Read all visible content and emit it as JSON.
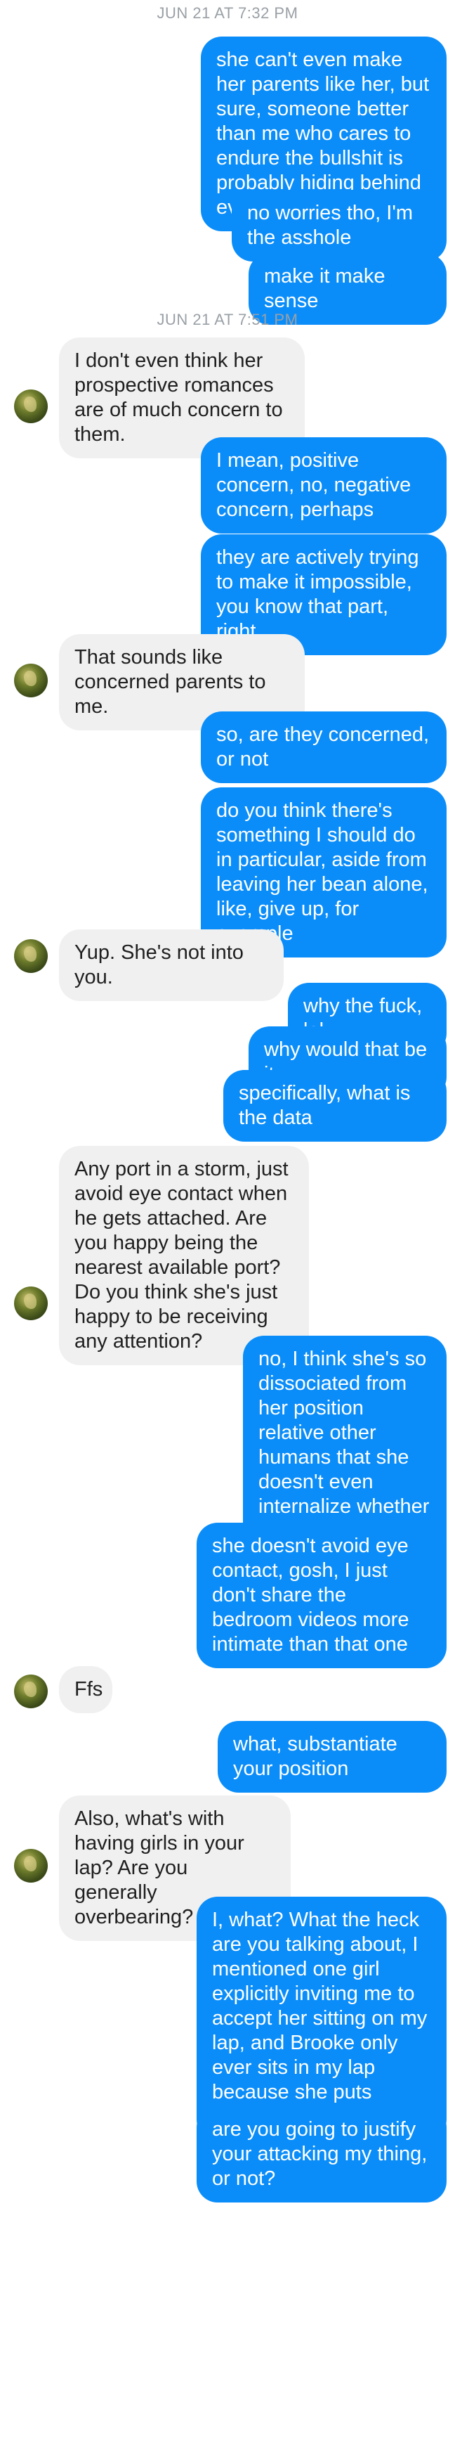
{
  "timestamps": [
    "JUN 21 AT 7:32 PM",
    "JUN 21 AT 7:51 PM"
  ],
  "messages": [
    {
      "dir": "out",
      "text": "she can't even make her parents like her, but sure, someone better than me who cares to endure the bullshit is probably hiding behind every bush"
    },
    {
      "dir": "out",
      "text": "no worries tho, I'm the asshole"
    },
    {
      "dir": "out",
      "text": "make it make sense"
    },
    {
      "dir": "in",
      "text": "I don't even think her prospective romances are of much concern to them."
    },
    {
      "dir": "out",
      "text": "I mean, positive concern, no, negative concern, perhaps"
    },
    {
      "dir": "out",
      "text": "they are actively trying to make it impossible, you know that part, right"
    },
    {
      "dir": "in",
      "text": "That sounds like concerned parents to me."
    },
    {
      "dir": "out",
      "text": "so, are they concerned, or not"
    },
    {
      "dir": "out",
      "text": "do you think there's something I should do in particular, aside from leaving her bean alone, like, give up, for example"
    },
    {
      "dir": "in",
      "text": "Yup. She's not into you."
    },
    {
      "dir": "out",
      "text": "why the fuck, lol"
    },
    {
      "dir": "out",
      "text": "why would that be it"
    },
    {
      "dir": "out",
      "text": "specifically, what is the data"
    },
    {
      "dir": "in",
      "text": "Any port in a storm, just avoid eye contact when he gets attached. Are you happy being the nearest available port? Do you think she's just happy to be receiving any attention?"
    },
    {
      "dir": "out",
      "text": "no, I think she's so dissociated from her position relative other humans that she doesn't even internalize whether she is getting special attention or not"
    },
    {
      "dir": "out",
      "text": "she doesn't avoid eye contact, gosh, I just don't share the bedroom videos more intimate than that one"
    },
    {
      "dir": "in",
      "text": "Ffs"
    },
    {
      "dir": "out",
      "text": "what, substantiate your position"
    },
    {
      "dir": "in",
      "text": "Also, what's with having girls in your lap? Are you generally overbearing?"
    },
    {
      "dir": "out",
      "text": "I, what? What the heck are you talking about, I mentioned one girl explicitly inviting me to accept her sitting on my lap, and Brooke only ever sits in my lap because she puts herself in my lap"
    },
    {
      "dir": "out",
      "text": "are you going to justify your attacking my thing, or not?"
    }
  ]
}
